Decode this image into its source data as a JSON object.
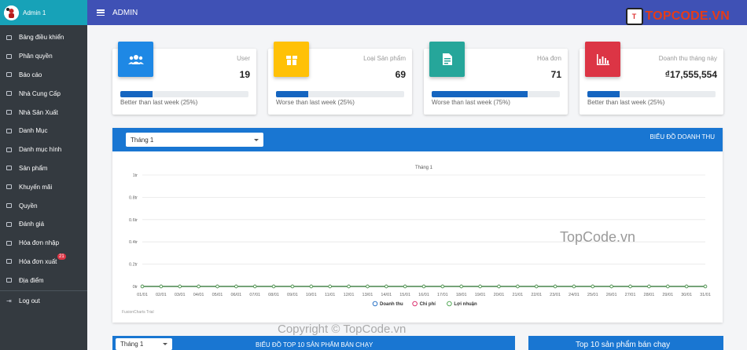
{
  "sidebar": {
    "user": "Admin 1",
    "items": [
      {
        "label": "Bảng điều khiển"
      },
      {
        "label": "Phân quyền"
      },
      {
        "label": "Báo cáo"
      },
      {
        "label": "Nhà Cung Cấp"
      },
      {
        "label": "Nhà Sản Xuất"
      },
      {
        "label": "Danh Mục"
      },
      {
        "label": "Danh mục hình"
      },
      {
        "label": "Sản phẩm"
      },
      {
        "label": "Khuyến mãi"
      },
      {
        "label": "Quyền"
      },
      {
        "label": "Đánh giá"
      },
      {
        "label": "Hóa đơn nhập"
      },
      {
        "label": "Hóa đơn xuất",
        "badge": "21"
      },
      {
        "label": "Địa điểm"
      }
    ],
    "logout": "Log out"
  },
  "header": {
    "title": "ADMIN",
    "brand": "TOPCODE.VN",
    "brand_mark": "T"
  },
  "cards": [
    {
      "label": "User",
      "value": "19",
      "progress": 0.25,
      "desc": "Better than last week (25%)",
      "color": "#1e88e5",
      "icon": "users-icon"
    },
    {
      "label": "Loại Sản phẩm",
      "value": "69",
      "progress": 0.25,
      "desc": "Worse than last week (25%)",
      "color": "#ffc107",
      "icon": "box-icon"
    },
    {
      "label": "Hóa đơn",
      "value": "71",
      "progress": 0.75,
      "desc": "Worse than last week (75%)",
      "color": "#26a69a",
      "icon": "invoice-icon"
    },
    {
      "label": "Doanh thu tháng này",
      "value": "₫17,555,554",
      "progress": 0.25,
      "desc": "Better than last week (25%)",
      "color": "#dc3545",
      "icon": "bar-chart-icon"
    }
  ],
  "revenue": {
    "select": "Tháng 1",
    "title": "BIỂU ĐỒ DOANH THU"
  },
  "chart_data": {
    "type": "line",
    "title": "Tháng 1",
    "x": [
      "01/01",
      "02/01",
      "03/01",
      "04/01",
      "05/01",
      "06/01",
      "07/01",
      "08/01",
      "09/01",
      "10/01",
      "11/01",
      "12/01",
      "13/01",
      "14/01",
      "15/01",
      "16/01",
      "17/01",
      "18/01",
      "19/01",
      "20/01",
      "21/01",
      "22/01",
      "23/01",
      "24/01",
      "25/01",
      "26/01",
      "27/01",
      "28/01",
      "29/01",
      "30/01",
      "31/01"
    ],
    "y_ticks": [
      "0tr",
      "0.2tr",
      "0.4tr",
      "0.6tr",
      "0.8tr",
      "1tr"
    ],
    "ylim": [
      0,
      1
    ],
    "series": [
      {
        "name": "Doanh thu",
        "values": [
          0,
          0,
          0,
          0,
          0,
          0,
          0,
          0,
          0,
          0,
          0,
          0,
          0,
          0,
          0,
          0,
          0,
          0,
          0,
          0,
          0,
          0,
          0,
          0,
          0,
          0,
          0,
          0,
          0,
          0,
          0
        ],
        "color": "#1565c0"
      },
      {
        "name": "Chi phí",
        "values": [
          0,
          0,
          0,
          0,
          0,
          0,
          0,
          0,
          0,
          0,
          0,
          0,
          0,
          0,
          0,
          0,
          0,
          0,
          0,
          0,
          0,
          0,
          0,
          0,
          0,
          0,
          0,
          0,
          0,
          0,
          0
        ],
        "color": "#d81b60"
      },
      {
        "name": "Lợi nhuận",
        "values": [
          0,
          0,
          0,
          0,
          0,
          0,
          0,
          0,
          0,
          0,
          0,
          0,
          0,
          0,
          0,
          0,
          0,
          0,
          0,
          0,
          0,
          0,
          0,
          0,
          0,
          0,
          0,
          0,
          0,
          0,
          0
        ],
        "color": "#43a047"
      }
    ],
    "legend": "bottom",
    "grid": true,
    "credit": "FusionCharts Trial"
  },
  "top_products": {
    "select": "Tháng 1",
    "title": "BIỂU ĐỒ TOP 10 SẢN PHẨM BÁN CHẠY",
    "side_title": "Top 10 sản phẩm bán chạy"
  },
  "watermarks": {
    "main": "TopCode.vn",
    "copyright": "Copyright © TopCode.vn"
  }
}
